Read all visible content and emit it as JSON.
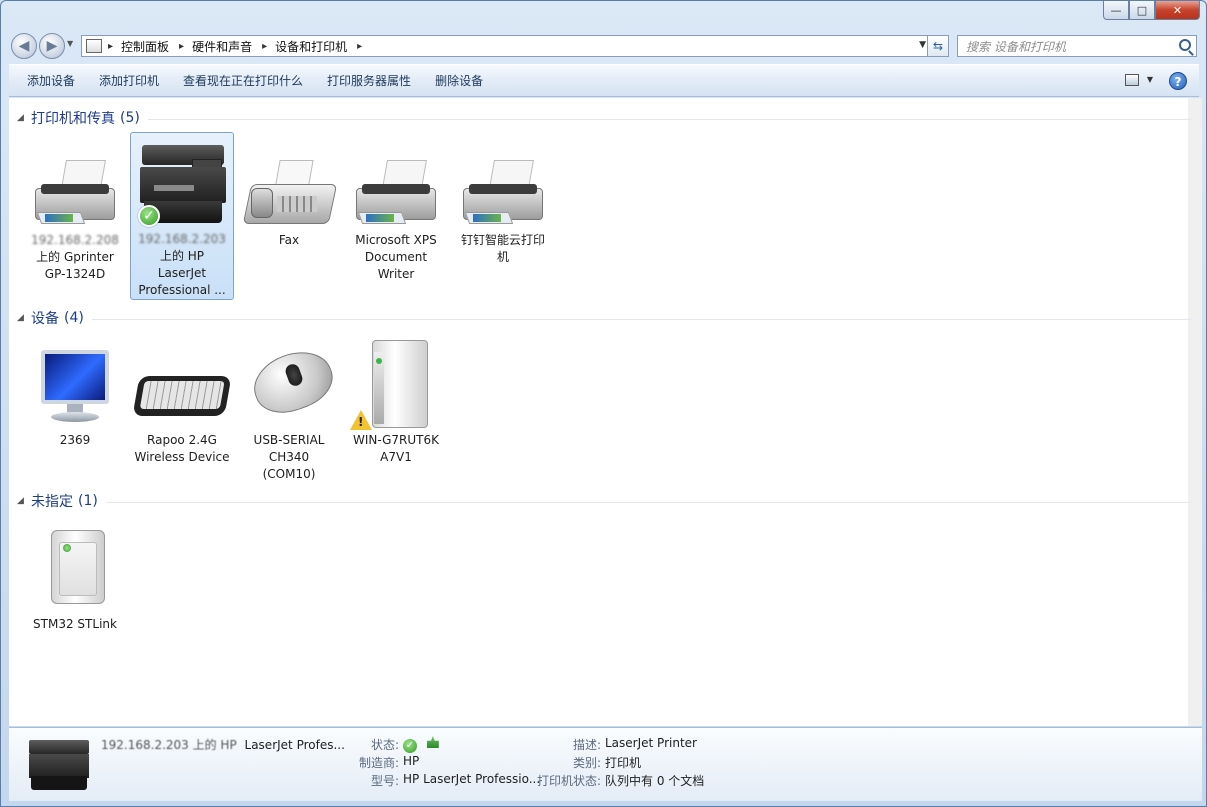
{
  "window": {
    "caption_buttons": {
      "minimize": "—",
      "maximize": "□",
      "close": "✕"
    }
  },
  "address_bar": {
    "breadcrumbs": [
      "控制面板",
      "硬件和声音",
      "设备和打印机"
    ],
    "search_placeholder": "搜索 设备和打印机"
  },
  "command_bar": {
    "items": [
      "添加设备",
      "添加打印机",
      "查看现在正在打印什么",
      "打印服务器属性",
      "删除设备"
    ],
    "help": "?"
  },
  "groups": {
    "printers": {
      "title": "打印机和传真",
      "count": "(5)",
      "items": [
        {
          "line1": "192.168.2.208",
          "line2": "上的 Gprinter",
          "line3": "GP-1324D",
          "line4": ""
        },
        {
          "line1": "192.168.2.203",
          "line2": "上的 HP",
          "line3": "LaserJet",
          "line4": "Professional ..."
        },
        {
          "line1": "Fax",
          "line2": "",
          "line3": "",
          "line4": ""
        },
        {
          "line1": "Microsoft XPS",
          "line2": "Document",
          "line3": "Writer",
          "line4": ""
        },
        {
          "line1": "钉钉智能云打印",
          "line2": "机",
          "line3": "",
          "line4": ""
        }
      ]
    },
    "devices": {
      "title": "设备",
      "count": "(4)",
      "items": [
        {
          "line1": "2369",
          "line2": "",
          "line3": ""
        },
        {
          "line1": "Rapoo 2.4G",
          "line2": "Wireless Device",
          "line3": ""
        },
        {
          "line1": "USB-SERIAL",
          "line2": "CH340",
          "line3": "(COM10)"
        },
        {
          "line1": "WIN-G7RUT6K",
          "line2": "A7V1",
          "line3": ""
        }
      ]
    },
    "unspecified": {
      "title": "未指定",
      "count": "(1)",
      "items": [
        {
          "line1": "STM32 STLink"
        }
      ]
    }
  },
  "details": {
    "name_blurred": "192.168.2.203 上的 HP",
    "name": "LaserJet Profes...",
    "status_label": "状态:",
    "manufacturer_label": "制造商:",
    "manufacturer": "HP",
    "model_label": "型号:",
    "model": "HP LaserJet Professio...",
    "description_label": "描述:",
    "description": "LaserJet Printer",
    "category_label": "类别:",
    "category": "打印机",
    "print_status_label": "打印机状态:",
    "print_status": "队列中有 0 个文档"
  }
}
